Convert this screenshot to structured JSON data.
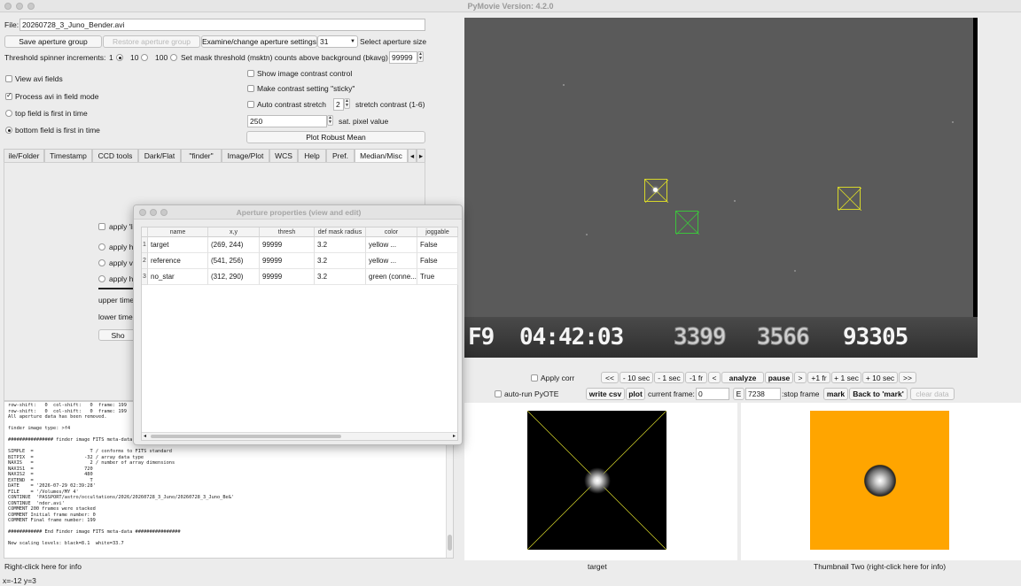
{
  "window": {
    "title": "PyMovie  Version: 4.2.0"
  },
  "file": {
    "label": "File:",
    "value": "20260728_3_Juno_Bender.avi"
  },
  "toolbar": {
    "save_aperture_group": "Save aperture group",
    "restore_aperture_group": "Restore aperture group",
    "examine_aperture": "Examine/change aperture settings",
    "aperture_size_value": "31",
    "aperture_size_label": "Select aperture size"
  },
  "threshold": {
    "label": "Threshold spinner increments:",
    "opt1": "1",
    "opt2": "10",
    "opt3": "100",
    "mask_label": "Set mask threshold (msktn) counts above background (bkavg)",
    "mask_value": "99999"
  },
  "options": {
    "view_avi_fields": "View avi fields",
    "process_field_mode": "Process avi in field mode",
    "top_field_first": "top field is first in time",
    "bottom_field_first": "bottom field is first in time",
    "show_contrast": "Show image contrast control",
    "sticky_contrast": "Make contrast setting \"sticky\"",
    "auto_contrast": "Auto contrast stretch",
    "stretch_value": "2",
    "stretch_label": "stretch contrast (1-6)",
    "sat_value": "250",
    "sat_label": "sat. pixel value",
    "plot_robust_mean": "Plot Robust Mean"
  },
  "tabs": [
    "ile/Folder",
    "Timestamp",
    "CCD tools",
    "Dark/Flat",
    "\"finder\"",
    "Image/Plot",
    "WCS",
    "Help",
    "Pref.",
    "Median/Misc"
  ],
  "median_panel": {
    "apply_1": "apply 'li",
    "apply_2": "apply he",
    "apply_3": "apply ve",
    "apply_4": "apply h",
    "upper_time": "upper time",
    "lower_time": "lower times",
    "show_btn": "Sho"
  },
  "log": {
    "lines": [
      "row-shift:   0  col-shift:   0  frame: 199",
      "row-shift:   0  col-shift:   0  frame: 199",
      "All aperture data has been removed.",
      "",
      "finder image type: >f4",
      "",
      "################ finder image FITS meta-data ################",
      "",
      "SIMPLE  =                    T / conforms to FITS standard",
      "BITPIX  =                  -32 / array data type",
      "NAXIS   =                    2 / number of array dimensions",
      "NAXIS1  =                  720",
      "NAXIS2  =                  480",
      "EXTEND  =                    T",
      "DATE    = '2026-07-29 02:39:28'",
      "FILE    = '/Volumes/MY 4'",
      "CONTINUE  'PASSPORT/astro/occultations/2026/20260728_3_Juno/20260728_3_Juno_Be&'",
      "CONTINUE  'nder.avi'",
      "COMMENT 200 frames were stacked",
      "COMMENT Initial frame number: 0",
      "COMMENT Final frame number: 199",
      "",
      "############ End Finder image FITS meta-data ################",
      "",
      "New scaling levels: black=8.1  white=33.7"
    ]
  },
  "dialog": {
    "title": "Aperture properties (view and edit)",
    "columns": [
      "name",
      "x,y",
      "thresh",
      "def mask radius",
      "color",
      "joggable"
    ],
    "rows": [
      {
        "idx": "1",
        "name": "target",
        "xy": "(269, 244)",
        "thresh": "99999",
        "radius": "3.2",
        "color": "yellow ...",
        "joggable": "False"
      },
      {
        "idx": "2",
        "name": "reference",
        "xy": "(541, 256)",
        "thresh": "99999",
        "radius": "3.2",
        "color": "yellow ...",
        "joggable": "False"
      },
      {
        "idx": "3",
        "name": "no_star",
        "xy": "(312, 290)",
        "thresh": "99999",
        "radius": "3.2",
        "color": "green (conne...",
        "joggable": "True"
      }
    ]
  },
  "image": {
    "timestamp": {
      "field": "F9",
      "time": "04:42:03",
      "n1": "3399",
      "n2": "3566",
      "n3": "93305"
    }
  },
  "playback": {
    "apply_corr": "Apply corr",
    "first": "<<",
    "back10": "- 10 sec",
    "back1": "- 1 sec",
    "back1fr": "-1 fr",
    "back": "<",
    "analyze": "analyze",
    "pause": "pause",
    "fwd": ">",
    "fwd1fr": "+1 fr",
    "fwd1": "+ 1 sec",
    "fwd10": "+ 10 sec",
    "last": ">>",
    "auto_pyote": "auto-run PyOTE",
    "write_csv": "write csv",
    "plot": "plot",
    "current_frame_label": "current frame:",
    "current_frame_value": "0",
    "stop_e": "E",
    "stop_value": "7238",
    "stop_label": ":stop frame",
    "mark": "mark",
    "back_to_mark": "Back to 'mark'",
    "clear_data": "clear data"
  },
  "bottom": {
    "left_info": "Right-click here for info",
    "thumb1_label": "target",
    "thumb2_label": "Thumbnail Two (right-click here for info)",
    "coords": "x=-12 y=3"
  },
  "colors": {
    "aperture_yellow": "#d7d72a",
    "aperture_green": "#3cc43c",
    "thumb2_bg": "#ffa500"
  }
}
